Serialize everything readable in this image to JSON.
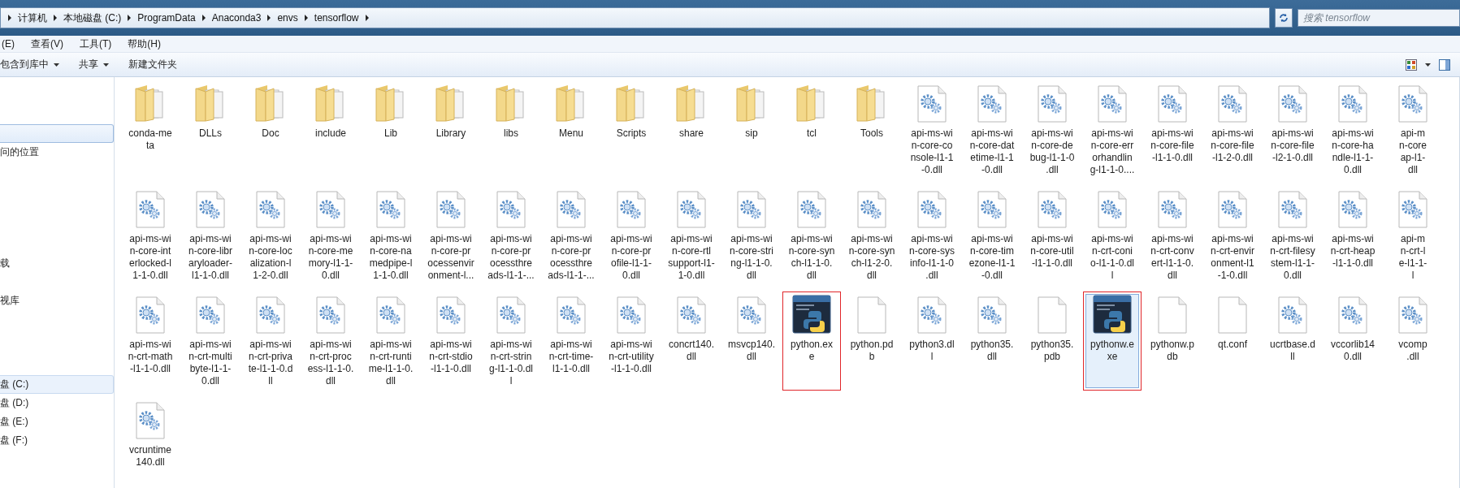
{
  "address_bar": {
    "path": [
      "计算机",
      "本地磁盘 (C:)",
      "ProgramData",
      "Anaconda3",
      "envs",
      "tensorflow"
    ]
  },
  "search": {
    "placeholder": "搜索 tensorflow"
  },
  "menu_bar": [
    "(E)",
    "查看(V)",
    "工具(T)",
    "帮助(H)"
  ],
  "toolbar": {
    "buttons": [
      {
        "label": "包含到库中",
        "dropdown": true
      },
      {
        "label": "共享",
        "dropdown": true
      },
      {
        "label": "新建文件夹",
        "dropdown": false
      }
    ]
  },
  "sidebar": {
    "groups": [
      {
        "items": [
          {
            "selected": true
          },
          {
            "label": "问的位置",
            "selected": false
          }
        ]
      },
      {
        "items": [
          {
            "label": "载",
            "selected": false
          },
          {
            "label": "视库",
            "selected": false
          }
        ]
      },
      {
        "items": [
          {
            "label": "盘 (C:)",
            "selected": true
          },
          {
            "label": "盘 (D:)",
            "selected": false
          },
          {
            "label": "盘 (E:)",
            "selected": false
          },
          {
            "label": "盘 (F:)",
            "selected": false
          }
        ]
      }
    ]
  },
  "files": [
    {
      "kind": "folder",
      "lines": [
        "conda-me",
        "ta"
      ],
      "selected": false,
      "marked": false
    },
    {
      "kind": "folder",
      "lines": [
        "DLLs"
      ],
      "selected": false,
      "marked": false
    },
    {
      "kind": "folder",
      "lines": [
        "Doc"
      ],
      "selected": false,
      "marked": false
    },
    {
      "kind": "folder",
      "lines": [
        "include"
      ],
      "selected": false,
      "marked": false
    },
    {
      "kind": "folder",
      "lines": [
        "Lib"
      ],
      "selected": false,
      "marked": false
    },
    {
      "kind": "folder",
      "lines": [
        "Library"
      ],
      "selected": false,
      "marked": false
    },
    {
      "kind": "folder",
      "lines": [
        "libs"
      ],
      "selected": false,
      "marked": false
    },
    {
      "kind": "folder",
      "lines": [
        "Menu"
      ],
      "selected": false,
      "marked": false
    },
    {
      "kind": "folder",
      "lines": [
        "Scripts"
      ],
      "selected": false,
      "marked": false
    },
    {
      "kind": "folder",
      "lines": [
        "share"
      ],
      "selected": false,
      "marked": false
    },
    {
      "kind": "folder",
      "lines": [
        "sip"
      ],
      "selected": false,
      "marked": false
    },
    {
      "kind": "folder",
      "lines": [
        "tcl"
      ],
      "selected": false,
      "marked": false
    },
    {
      "kind": "folder",
      "lines": [
        "Tools"
      ],
      "selected": false,
      "marked": false
    },
    {
      "kind": "dll",
      "lines": [
        "api-ms-wi",
        "n-core-co",
        "nsole-l1-1",
        "-0.dll"
      ],
      "selected": false,
      "marked": false
    },
    {
      "kind": "dll",
      "lines": [
        "api-ms-wi",
        "n-core-dat",
        "etime-l1-1",
        "-0.dll"
      ],
      "selected": false,
      "marked": false
    },
    {
      "kind": "dll",
      "lines": [
        "api-ms-wi",
        "n-core-de",
        "bug-l1-1-0",
        ".dll"
      ],
      "selected": false,
      "marked": false
    },
    {
      "kind": "dll",
      "lines": [
        "api-ms-wi",
        "n-core-err",
        "orhandlin",
        "g-l1-1-0...."
      ],
      "selected": false,
      "marked": false
    },
    {
      "kind": "dll",
      "lines": [
        "api-ms-wi",
        "n-core-file",
        "-l1-1-0.dll"
      ],
      "selected": false,
      "marked": false
    },
    {
      "kind": "dll",
      "lines": [
        "api-ms-wi",
        "n-core-file",
        "-l1-2-0.dll"
      ],
      "selected": false,
      "marked": false
    },
    {
      "kind": "dll",
      "lines": [
        "api-ms-wi",
        "n-core-file",
        "-l2-1-0.dll"
      ],
      "selected": false,
      "marked": false
    },
    {
      "kind": "dll",
      "lines": [
        "api-ms-wi",
        "n-core-ha",
        "ndle-l1-1-",
        "0.dll"
      ],
      "selected": false,
      "marked": false
    },
    {
      "kind": "dll",
      "lines": [
        "api-m",
        "n-core",
        "ap-l1-",
        "dll"
      ],
      "selected": false,
      "marked": false
    },
    {
      "kind": "dll",
      "lines": [
        "api-ms-wi",
        "n-core-int",
        "erlocked-l",
        "1-1-0.dll"
      ],
      "selected": false,
      "marked": false
    },
    {
      "kind": "dll",
      "lines": [
        "api-ms-wi",
        "n-core-libr",
        "aryloader-",
        "l1-1-0.dll"
      ],
      "selected": false,
      "marked": false
    },
    {
      "kind": "dll",
      "lines": [
        "api-ms-wi",
        "n-core-loc",
        "alization-l",
        "1-2-0.dll"
      ],
      "selected": false,
      "marked": false
    },
    {
      "kind": "dll",
      "lines": [
        "api-ms-wi",
        "n-core-me",
        "mory-l1-1-",
        "0.dll"
      ],
      "selected": false,
      "marked": false
    },
    {
      "kind": "dll",
      "lines": [
        "api-ms-wi",
        "n-core-na",
        "medpipe-l",
        "1-1-0.dll"
      ],
      "selected": false,
      "marked": false
    },
    {
      "kind": "dll",
      "lines": [
        "api-ms-wi",
        "n-core-pr",
        "ocessenvir",
        "onment-l..."
      ],
      "selected": false,
      "marked": false
    },
    {
      "kind": "dll",
      "lines": [
        "api-ms-wi",
        "n-core-pr",
        "ocessthre",
        "ads-l1-1-..."
      ],
      "selected": false,
      "marked": false
    },
    {
      "kind": "dll",
      "lines": [
        "api-ms-wi",
        "n-core-pr",
        "ocessthre",
        "ads-l1-1-..."
      ],
      "selected": false,
      "marked": false
    },
    {
      "kind": "dll",
      "lines": [
        "api-ms-wi",
        "n-core-pr",
        "ofile-l1-1-",
        "0.dll"
      ],
      "selected": false,
      "marked": false
    },
    {
      "kind": "dll",
      "lines": [
        "api-ms-wi",
        "n-core-rtl",
        "support-l1-",
        "1-0.dll"
      ],
      "selected": false,
      "marked": false
    },
    {
      "kind": "dll",
      "lines": [
        "api-ms-wi",
        "n-core-stri",
        "ng-l1-1-0.",
        "dll"
      ],
      "selected": false,
      "marked": false
    },
    {
      "kind": "dll",
      "lines": [
        "api-ms-wi",
        "n-core-syn",
        "ch-l1-1-0.",
        "dll"
      ],
      "selected": false,
      "marked": false
    },
    {
      "kind": "dll",
      "lines": [
        "api-ms-wi",
        "n-core-syn",
        "ch-l1-2-0.",
        "dll"
      ],
      "selected": false,
      "marked": false
    },
    {
      "kind": "dll",
      "lines": [
        "api-ms-wi",
        "n-core-sys",
        "info-l1-1-0",
        ".dll"
      ],
      "selected": false,
      "marked": false
    },
    {
      "kind": "dll",
      "lines": [
        "api-ms-wi",
        "n-core-tim",
        "ezone-l1-1",
        "-0.dll"
      ],
      "selected": false,
      "marked": false
    },
    {
      "kind": "dll",
      "lines": [
        "api-ms-wi",
        "n-core-util",
        "-l1-1-0.dll"
      ],
      "selected": false,
      "marked": false
    },
    {
      "kind": "dll",
      "lines": [
        "api-ms-wi",
        "n-crt-coni",
        "o-l1-1-0.dl",
        "l"
      ],
      "selected": false,
      "marked": false
    },
    {
      "kind": "dll",
      "lines": [
        "api-ms-wi",
        "n-crt-conv",
        "ert-l1-1-0.",
        "dll"
      ],
      "selected": false,
      "marked": false
    },
    {
      "kind": "dll",
      "lines": [
        "api-ms-wi",
        "n-crt-envir",
        "onment-l1",
        "-1-0.dll"
      ],
      "selected": false,
      "marked": false
    },
    {
      "kind": "dll",
      "lines": [
        "api-ms-wi",
        "n-crt-filesy",
        "stem-l1-1-",
        "0.dll"
      ],
      "selected": false,
      "marked": false
    },
    {
      "kind": "dll",
      "lines": [
        "api-ms-wi",
        "n-crt-heap",
        "-l1-1-0.dll"
      ],
      "selected": false,
      "marked": false
    },
    {
      "kind": "dll",
      "lines": [
        "api-m",
        "n-crt-l",
        "e-l1-1-",
        "l"
      ],
      "selected": false,
      "marked": false
    },
    {
      "kind": "dll",
      "lines": [
        "api-ms-wi",
        "n-crt-math",
        "-l1-1-0.dll"
      ],
      "selected": false,
      "marked": false
    },
    {
      "kind": "dll",
      "lines": [
        "api-ms-wi",
        "n-crt-multi",
        "byte-l1-1-",
        "0.dll"
      ],
      "selected": false,
      "marked": false
    },
    {
      "kind": "dll",
      "lines": [
        "api-ms-wi",
        "n-crt-priva",
        "te-l1-1-0.d",
        "ll"
      ],
      "selected": false,
      "marked": false
    },
    {
      "kind": "dll",
      "lines": [
        "api-ms-wi",
        "n-crt-proc",
        "ess-l1-1-0.",
        "dll"
      ],
      "selected": false,
      "marked": false
    },
    {
      "kind": "dll",
      "lines": [
        "api-ms-wi",
        "n-crt-runti",
        "me-l1-1-0.",
        "dll"
      ],
      "selected": false,
      "marked": false
    },
    {
      "kind": "dll",
      "lines": [
        "api-ms-wi",
        "n-crt-stdio",
        "-l1-1-0.dll"
      ],
      "selected": false,
      "marked": false
    },
    {
      "kind": "dll",
      "lines": [
        "api-ms-wi",
        "n-crt-strin",
        "g-l1-1-0.dl",
        "l"
      ],
      "selected": false,
      "marked": false
    },
    {
      "kind": "dll",
      "lines": [
        "api-ms-wi",
        "n-crt-time-",
        "l1-1-0.dll"
      ],
      "selected": false,
      "marked": false
    },
    {
      "kind": "dll",
      "lines": [
        "api-ms-wi",
        "n-crt-utility",
        "-l1-1-0.dll"
      ],
      "selected": false,
      "marked": false
    },
    {
      "kind": "dll",
      "lines": [
        "concrt140.",
        "dll"
      ],
      "selected": false,
      "marked": false
    },
    {
      "kind": "dll",
      "lines": [
        "msvcp140.",
        "dll"
      ],
      "selected": false,
      "marked": false
    },
    {
      "kind": "exe",
      "lines": [
        "python.ex",
        "e"
      ],
      "selected": false,
      "marked": true
    },
    {
      "kind": "file",
      "lines": [
        "python.pd",
        "b"
      ],
      "selected": false,
      "marked": false
    },
    {
      "kind": "dll",
      "lines": [
        "python3.dl",
        "l"
      ],
      "selected": false,
      "marked": false
    },
    {
      "kind": "dll",
      "lines": [
        "python35.",
        "dll"
      ],
      "selected": false,
      "marked": false
    },
    {
      "kind": "file",
      "lines": [
        "python35.",
        "pdb"
      ],
      "selected": false,
      "marked": false
    },
    {
      "kind": "exe",
      "lines": [
        "pythonw.e",
        "xe"
      ],
      "selected": true,
      "marked": true
    },
    {
      "kind": "file",
      "lines": [
        "pythonw.p",
        "db"
      ],
      "selected": false,
      "marked": false
    },
    {
      "kind": "file",
      "lines": [
        "qt.conf"
      ],
      "selected": false,
      "marked": false
    },
    {
      "kind": "dll",
      "lines": [
        "ucrtbase.d",
        "ll"
      ],
      "selected": false,
      "marked": false
    },
    {
      "kind": "dll",
      "lines": [
        "vccorlib14",
        "0.dll"
      ],
      "selected": false,
      "marked": false
    },
    {
      "kind": "dll",
      "lines": [
        "vcomp",
        ".dll"
      ],
      "selected": false,
      "marked": false
    },
    {
      "kind": "dll",
      "lines": [
        "vcruntime",
        "140.dll"
      ],
      "selected": false,
      "marked": false
    }
  ]
}
